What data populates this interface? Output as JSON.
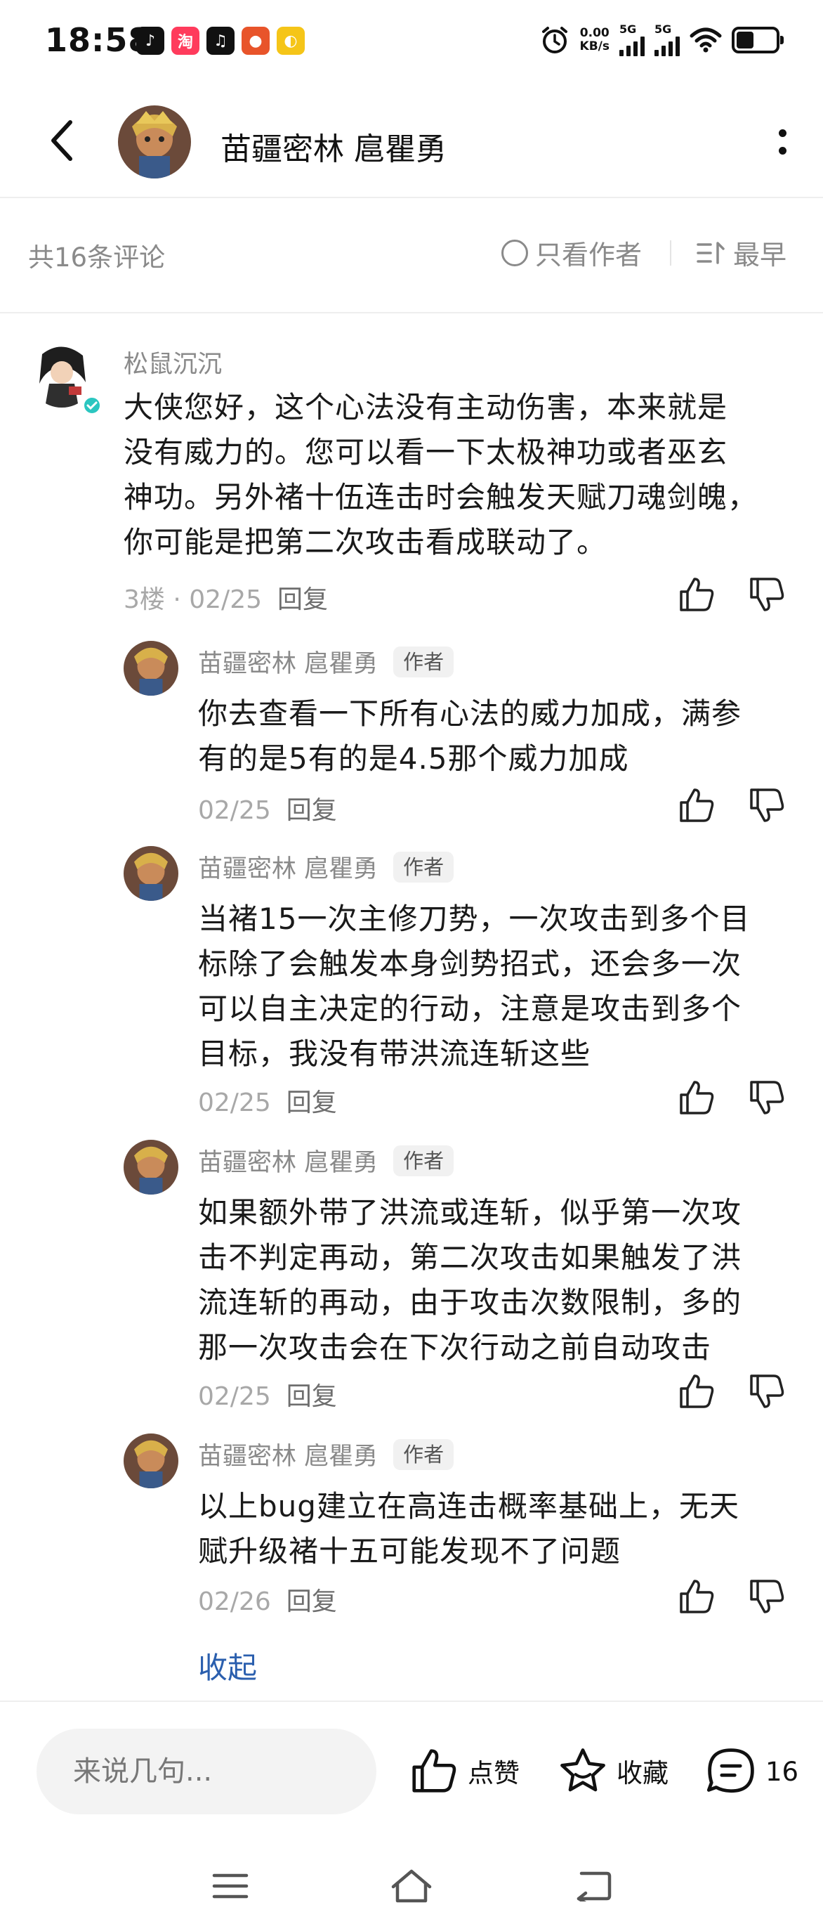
{
  "status_bar": {
    "time": "18:58",
    "net_speed_value": "0.00",
    "net_speed_unit": "KB/s",
    "signal1": "5G",
    "signal2": "5G"
  },
  "header": {
    "title": "苗疆密林 扈瞿勇"
  },
  "comment_bar": {
    "count_text": "共16条评论",
    "author_only": "只看作者",
    "sort": "最早"
  },
  "main_comment": {
    "user": "松鼠沉沉",
    "lines": [
      "大侠您好，这个心法没有主动伤害，本来就是",
      "没有威力的。您可以看一下太极神功或者巫玄",
      "神功。另外褚十伍连击时会触发天赋刀魂剑魄，",
      "你可能是把第二次攻击看成联动了。"
    ],
    "floor": "3楼",
    "date": "02/25",
    "reply": "回复"
  },
  "replies": [
    {
      "user": "苗疆密林 扈瞿勇",
      "tag": "作者",
      "lines": [
        "你去查看一下所有心法的威力加成，满参",
        "有的是5有的是4.5那个威力加成"
      ],
      "date": "02/25",
      "reply": "回复"
    },
    {
      "user": "苗疆密林 扈瞿勇",
      "tag": "作者",
      "lines": [
        "当褚15一次主修刀势，一次攻击到多个目",
        "标除了会触发本身剑势招式，还会多一次",
        "可以自主决定的行动，注意是攻击到多个",
        "目标，我没有带洪流连斩这些"
      ],
      "date": "02/25",
      "reply": "回复"
    },
    {
      "user": "苗疆密林 扈瞿勇",
      "tag": "作者",
      "lines": [
        "如果额外带了洪流或连斩，似乎第一次攻",
        "击不判定再动，第二次攻击如果触发了洪",
        "流连斩的再动，由于攻击次数限制，多的",
        "那一次攻击会在下次行动之前自动攻击"
      ],
      "date": "02/25",
      "reply": "回复"
    },
    {
      "user": "苗疆密林 扈瞿勇",
      "tag": "作者",
      "lines": [
        "以上bug建立在高连击概率基础上，无天",
        "赋升级褚十五可能发现不了问题"
      ],
      "date": "02/26",
      "reply": "回复"
    }
  ],
  "collapse_label": "收起",
  "bottom_bar": {
    "input_placeholder": "来说几句...",
    "like_label": "点赞",
    "fav_label": "收藏",
    "comment_count": "16"
  },
  "colors": {
    "link": "#2b5fae",
    "muted": "#8a8a8a",
    "verified": "#2bc6c0"
  }
}
